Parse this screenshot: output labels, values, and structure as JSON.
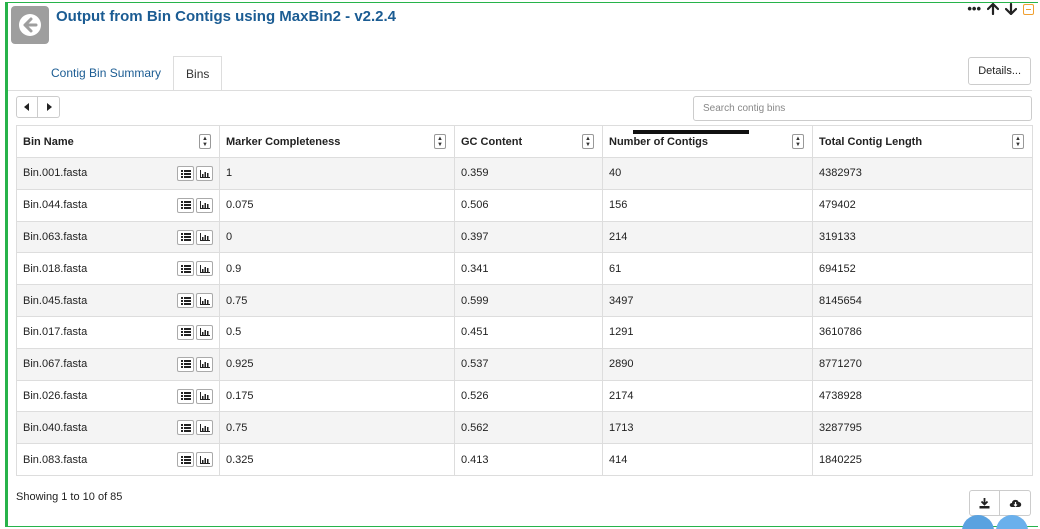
{
  "header": {
    "title": "Output from Bin Contigs using MaxBin2 - v2.2.4",
    "back_icon": "arrow-left-icon",
    "controls": {
      "more_icon": "ellipsis-icon",
      "up_icon": "arrow-up-icon",
      "down_icon": "arrow-down-icon",
      "minimize_icon": "minimize-icon"
    }
  },
  "tabs": [
    {
      "label": "Contig Bin Summary",
      "active": false
    },
    {
      "label": "Bins",
      "active": true
    }
  ],
  "details_label": "Details...",
  "search": {
    "placeholder": "Search contig bins",
    "value": ""
  },
  "table": {
    "columns": [
      "Bin Name",
      "Marker Completeness",
      "GC Content",
      "Number of Contigs",
      "Total Contig Length"
    ],
    "rows": [
      [
        "Bin.001.fasta",
        "1",
        "0.359",
        "40",
        "4382973"
      ],
      [
        "Bin.044.fasta",
        "0.075",
        "0.506",
        "156",
        "479402"
      ],
      [
        "Bin.063.fasta",
        "0",
        "0.397",
        "214",
        "319133"
      ],
      [
        "Bin.018.fasta",
        "0.9",
        "0.341",
        "61",
        "694152"
      ],
      [
        "Bin.045.fasta",
        "0.75",
        "0.599",
        "3497",
        "8145654"
      ],
      [
        "Bin.017.fasta",
        "0.5",
        "0.451",
        "1291",
        "3610786"
      ],
      [
        "Bin.067.fasta",
        "0.925",
        "0.537",
        "2890",
        "8771270"
      ],
      [
        "Bin.026.fasta",
        "0.175",
        "0.526",
        "2174",
        "4738928"
      ],
      [
        "Bin.040.fasta",
        "0.75",
        "0.562",
        "1713",
        "3287795"
      ],
      [
        "Bin.083.fasta",
        "0.325",
        "0.413",
        "414",
        "1840225"
      ]
    ]
  },
  "footer": {
    "showing": "Showing 1 to 10 of 85",
    "download_icon": "download-icon",
    "cloud_icon": "cloud-download-icon"
  },
  "colors": {
    "accent": "#1b5c93",
    "frame": "#27b34a",
    "back_button": "#9e9e9e"
  }
}
